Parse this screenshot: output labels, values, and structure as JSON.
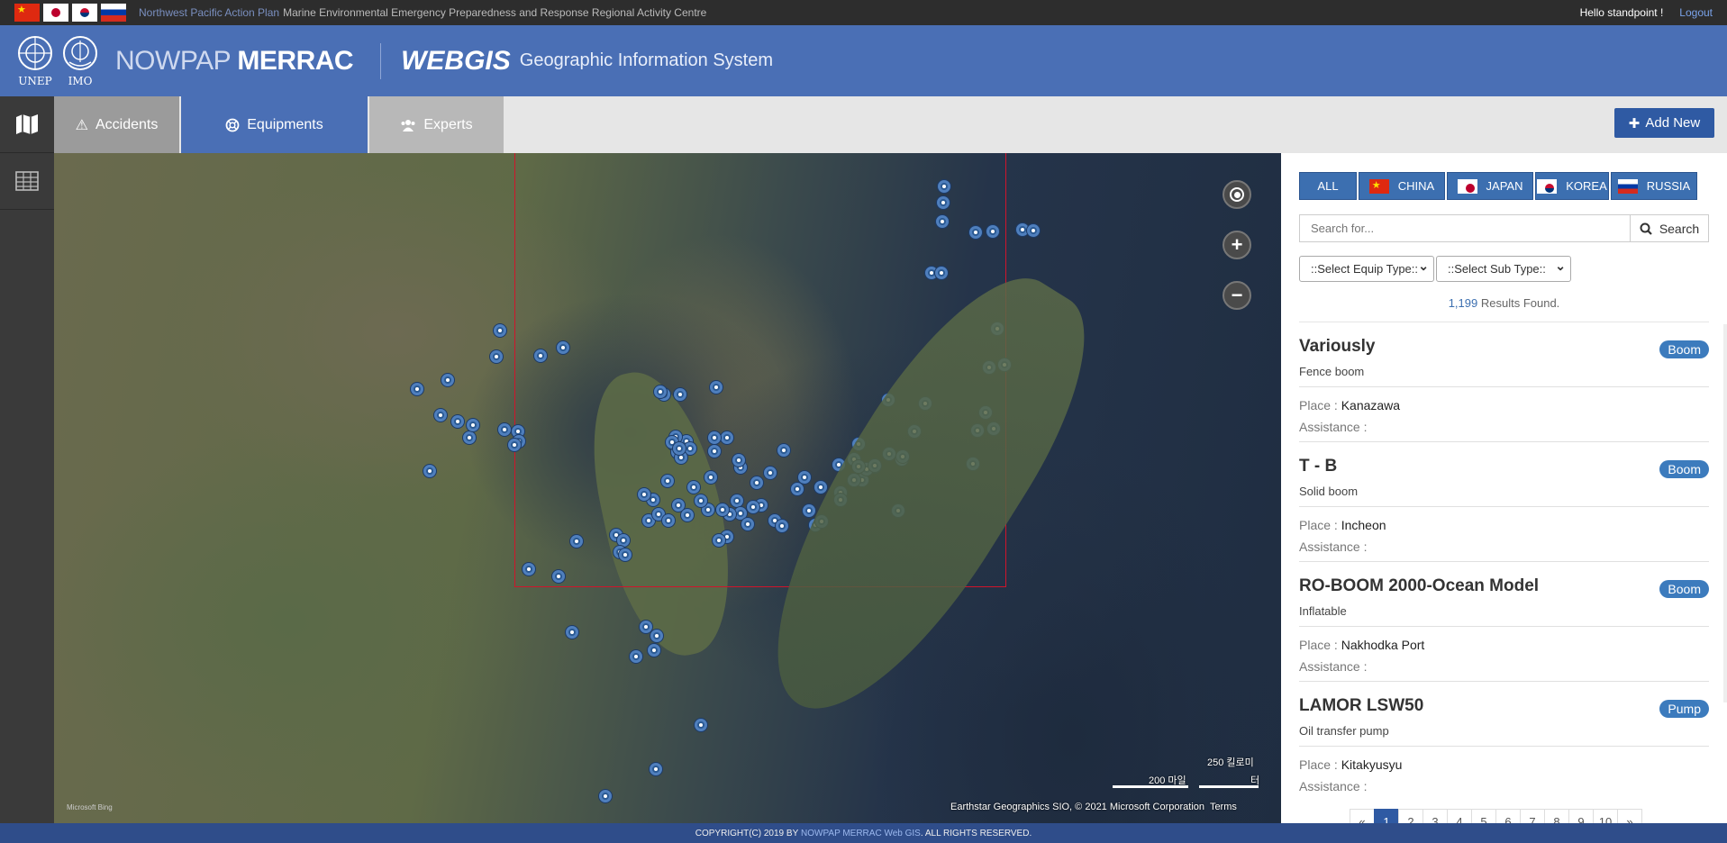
{
  "topbar": {
    "plan_label": "Northwest Pacific Action Plan",
    "centre_label": "Marine Environmental Emergency Preparedness and Response Regional Activity Centre",
    "greeting": "Hello standpoint !",
    "logout_label": "Logout",
    "flags": [
      "china-flag-icon",
      "japan-flag-icon",
      "korea-flag-icon",
      "russia-flag-icon"
    ]
  },
  "header": {
    "logo1_label": "UNEP",
    "logo2_label": "IMO",
    "brand_light": "NOWPAP",
    "brand_bold": "MERRAC",
    "webgis": "WEBGIS",
    "subtitle": "Geographic Information System",
    "color": "#4a6fb5"
  },
  "tabs": [
    {
      "label": "Accidents",
      "icon": "warning-icon"
    },
    {
      "label": "Equipments",
      "icon": "lifebuoy-icon"
    },
    {
      "label": "Experts",
      "icon": "users-icon"
    }
  ],
  "toolbar": {
    "add_new_label": "Add New"
  },
  "sidebar": {
    "items": [
      "map-icon",
      "table-icon"
    ]
  },
  "map": {
    "scale_top": "250 킬로미",
    "scale_bottom_left": "200 마일",
    "scale_bottom_right": "터",
    "attribution": "Earthstar Geographics SIO, © 2021 Microsoft Corporation",
    "terms": "Terms",
    "provider": "Microsoft Bing"
  },
  "countries": [
    {
      "label": "ALL"
    },
    {
      "label": "CHINA",
      "flag": "china"
    },
    {
      "label": "JAPAN",
      "flag": "japan"
    },
    {
      "label": "KOREA",
      "flag": "korea"
    },
    {
      "label": "RUSSIA",
      "flag": "russia"
    }
  ],
  "search": {
    "placeholder": "Search for...",
    "button_label": "Search"
  },
  "filters": {
    "equip_type": "::Select Equip Type::",
    "sub_type": "::Select Sub Type::"
  },
  "results": {
    "count": "1,199",
    "suffix": "Results Found."
  },
  "place_label": "Place :",
  "assistance_label": "Assistance :",
  "items": [
    {
      "title": "Variously",
      "sub": "Fence boom",
      "place": "Kanazawa",
      "badge": "Boom"
    },
    {
      "title": "T - B",
      "sub": "Solid boom",
      "place": "Incheon",
      "badge": "Boom"
    },
    {
      "title": "RO-BOOM 2000-Ocean Model",
      "sub": "Inflatable",
      "place": "Nakhodka Port",
      "badge": "Boom"
    },
    {
      "title": "LAMOR LSW50",
      "sub": "Oil transfer pump",
      "place": "Kitakyusyu",
      "badge": "Pump"
    }
  ],
  "pagination": [
    "«",
    "1",
    "2",
    "3",
    "4",
    "5",
    "6",
    "7",
    "8",
    "9",
    "10",
    "»"
  ],
  "pagination_active": "1",
  "footer": {
    "prefix": "COPYRIGHT(C) 2019 BY",
    "link": "NOWPAP MERRAC Web GIS",
    "suffix": ". ALL RIGHTS RESERVED."
  }
}
